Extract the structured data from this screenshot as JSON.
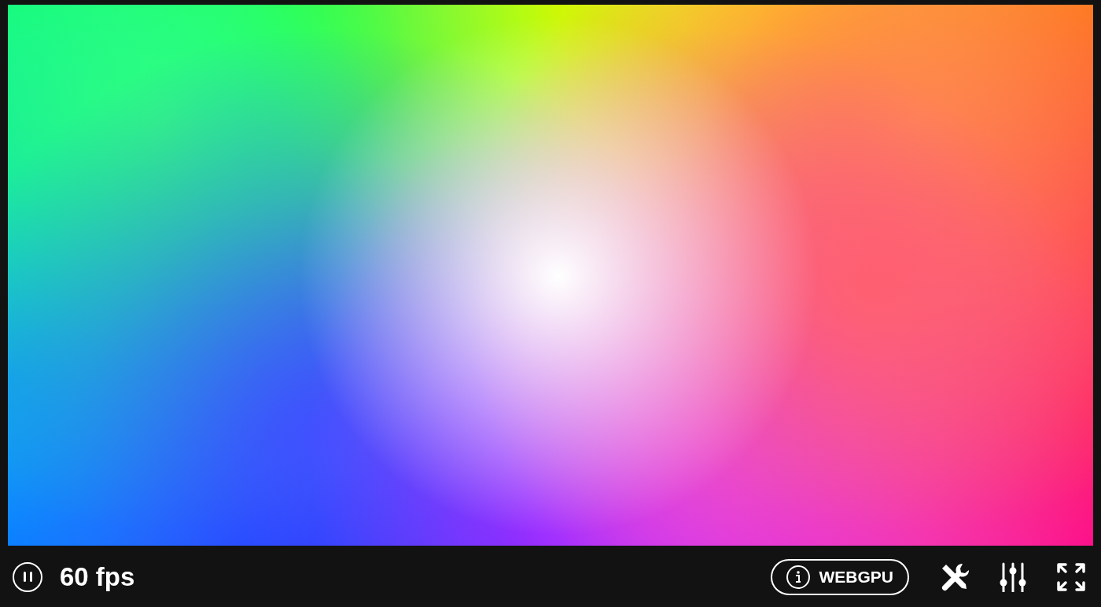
{
  "footer": {
    "fps": "60 fps",
    "api_badge": "WEBGPU"
  }
}
